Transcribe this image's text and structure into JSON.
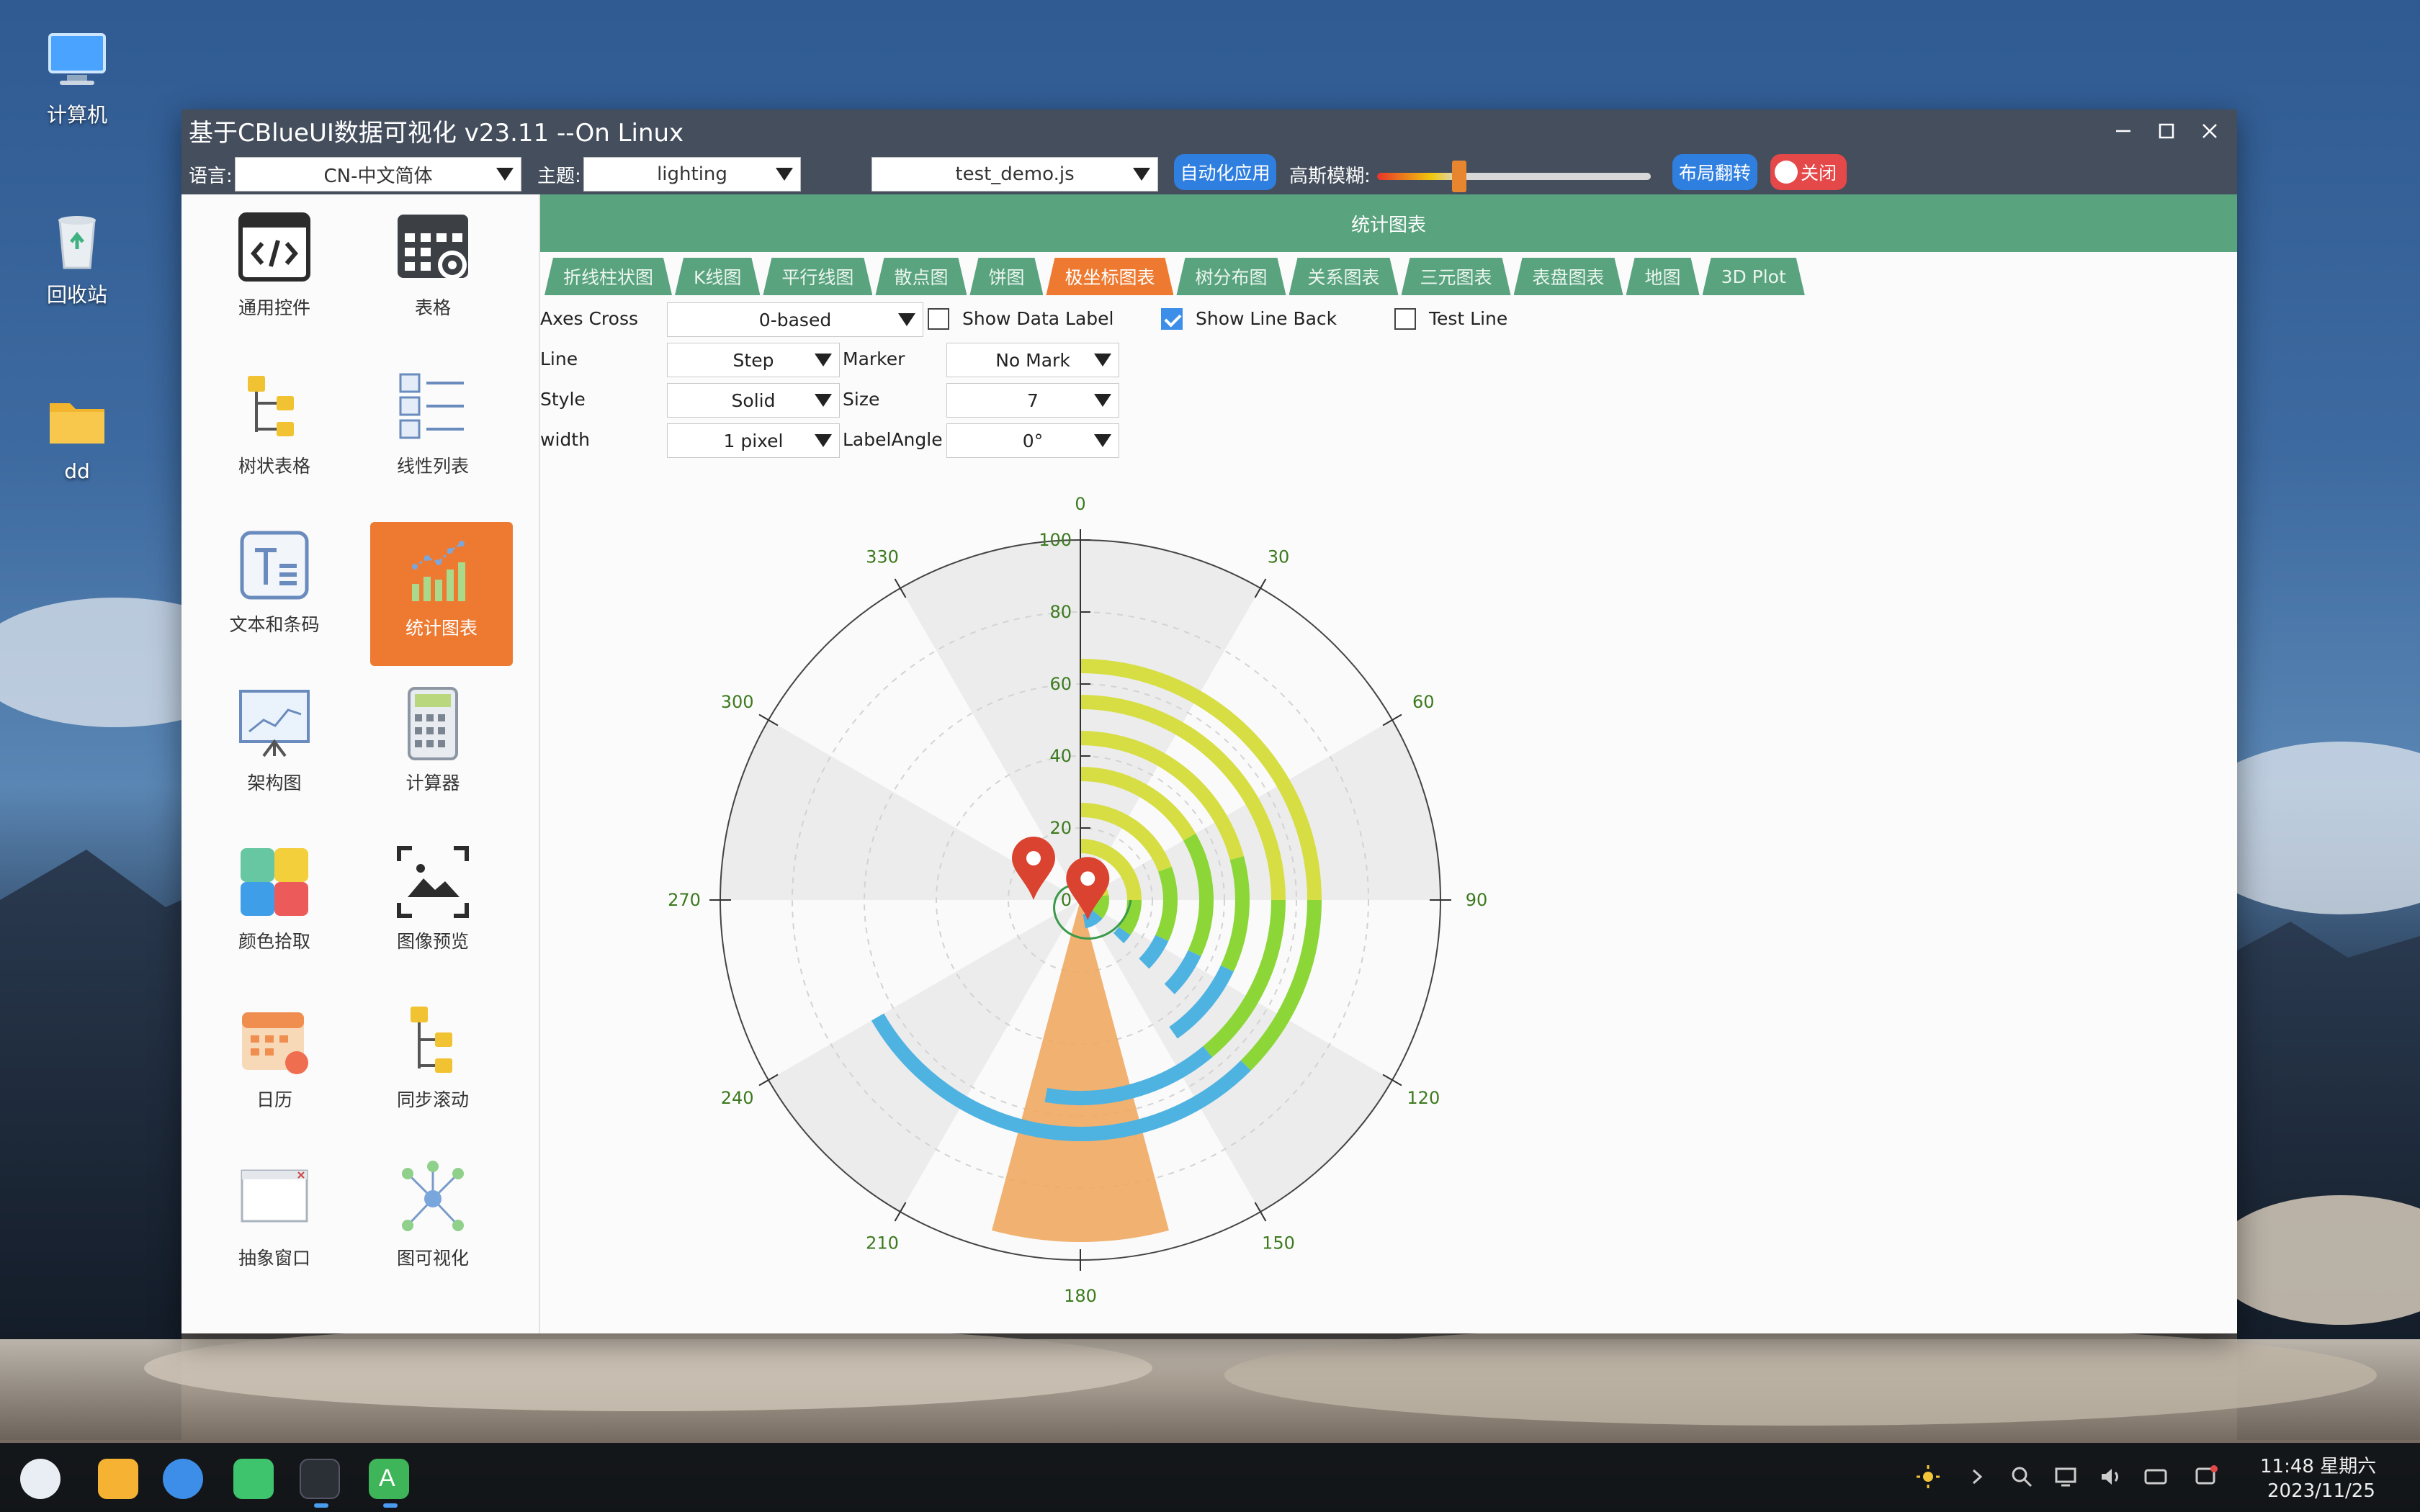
{
  "desktop": {
    "icons": [
      {
        "label": "计算机",
        "icon": "computer-icon"
      },
      {
        "label": "回收站",
        "icon": "trash-icon"
      },
      {
        "label": "dd",
        "icon": "folder-icon"
      }
    ]
  },
  "window": {
    "title": "基于CBlueUI数据可视化 v23.11 --On Linux",
    "controls": [
      "minimize-icon",
      "maximize-icon",
      "close-icon"
    ]
  },
  "toolbar": {
    "language_label": "语言:",
    "language_value": "CN-中文简体",
    "theme_label": "主题:",
    "theme_value": "lighting",
    "script_value": "test_demo.js",
    "auto_apply_label": "自动化应用",
    "blur_label": "高斯模糊:",
    "blur_level": 0.3,
    "layout_flip_label": "布局翻转",
    "close_label": "关闭"
  },
  "sidebar": {
    "items": [
      {
        "label": "通用控件",
        "icon": "code-icon"
      },
      {
        "label": "表格",
        "icon": "table-gear-icon"
      },
      {
        "label": "树状表格",
        "icon": "tree-table-icon"
      },
      {
        "label": "线性列表",
        "icon": "list-icon"
      },
      {
        "label": "文本和条码",
        "icon": "text-icon"
      },
      {
        "label": "统计图表",
        "icon": "chart-icon",
        "active": true
      },
      {
        "label": "架构图",
        "icon": "board-icon"
      },
      {
        "label": "计算器",
        "icon": "calculator-icon"
      },
      {
        "label": "颜色拾取",
        "icon": "palette-icon"
      },
      {
        "label": "图像预览",
        "icon": "image-preview-icon"
      },
      {
        "label": "日历",
        "icon": "calendar-icon"
      },
      {
        "label": "同步滚动",
        "icon": "sync-scroll-icon"
      },
      {
        "label": "抽象窗口",
        "icon": "window-icon"
      },
      {
        "label": "图可视化",
        "icon": "graph-icon"
      }
    ]
  },
  "main": {
    "header": "统计图表",
    "tabs": [
      "折线柱状图",
      "K线图",
      "平行线图",
      "散点图",
      "饼图",
      "极坐标图表",
      "树分布图",
      "关系图表",
      "三元图表",
      "表盘图表",
      "地图",
      "3D Plot"
    ],
    "active_tab": 5,
    "controls": {
      "axes_cross_label": "Axes Cross",
      "axes_cross_value": "0-based",
      "show_data_label": "Show Data Label",
      "show_data_label_checked": false,
      "show_line_back": "Show Line Back",
      "show_line_back_checked": true,
      "test_line": "Test Line",
      "test_line_checked": false,
      "line_label": "Line",
      "line_value": "Step",
      "marker_label": "Marker",
      "marker_value": "No Mark",
      "style_label": "Style",
      "style_value": "Solid",
      "size_label": "Size",
      "size_value": "7",
      "width_label": "width",
      "width_value": "1 pixel",
      "label_angle_label": "LabelAngle",
      "label_angle_value": "0°"
    }
  },
  "chart_data": {
    "type": "polar",
    "angle_ticks": [
      0,
      30,
      60,
      90,
      120,
      150,
      180,
      210,
      240,
      270,
      300,
      330
    ],
    "radius_ticks": [
      0,
      20,
      40,
      60,
      80,
      100
    ],
    "rlim": [
      0,
      100
    ],
    "background_sectors": [
      {
        "start": 0,
        "end": 30,
        "r": 100
      },
      {
        "start": 60,
        "end": 90,
        "r": 100
      },
      {
        "start": 120,
        "end": 150,
        "r": 100
      },
      {
        "start": 210,
        "end": 240,
        "r": 100
      },
      {
        "start": 270,
        "end": 300,
        "r": 100
      },
      {
        "start": 330,
        "end": 360,
        "r": 100
      }
    ],
    "orange_sector": {
      "start": 165,
      "end": 195,
      "r": 95,
      "color": "#f0a860"
    },
    "rings": [
      {
        "r": 65,
        "segments": [
          {
            "start": 0,
            "end": 90,
            "color": "#d6de44"
          },
          {
            "start": 90,
            "end": 135,
            "color": "#8dd638"
          },
          {
            "start": 135,
            "end": 240,
            "color": "#4fb3e2"
          }
        ]
      },
      {
        "r": 55,
        "segments": [
          {
            "start": 0,
            "end": 90,
            "color": "#d6de44"
          },
          {
            "start": 90,
            "end": 140,
            "color": "#8dd638"
          },
          {
            "start": 140,
            "end": 190,
            "color": "#4fb3e2"
          }
        ]
      },
      {
        "r": 45,
        "segments": [
          {
            "start": 0,
            "end": 75,
            "color": "#d6de44"
          },
          {
            "start": 75,
            "end": 115,
            "color": "#8dd638"
          },
          {
            "start": 115,
            "end": 145,
            "color": "#4fb3e2"
          }
        ]
      },
      {
        "r": 35,
        "segments": [
          {
            "start": 0,
            "end": 60,
            "color": "#d6de44"
          },
          {
            "start": 60,
            "end": 115,
            "color": "#8dd638"
          },
          {
            "start": 115,
            "end": 135,
            "color": "#4fb3e2"
          }
        ]
      },
      {
        "r": 25,
        "segments": [
          {
            "start": 0,
            "end": 70,
            "color": "#d6de44"
          },
          {
            "start": 70,
            "end": 115,
            "color": "#8dd638"
          },
          {
            "start": 115,
            "end": 135,
            "color": "#4fb3e2"
          }
        ]
      },
      {
        "r": 15,
        "segments": [
          {
            "start": 0,
            "end": 90,
            "color": "#d6de44"
          },
          {
            "start": 90,
            "end": 125,
            "color": "#8dd638"
          },
          {
            "start": 125,
            "end": 135,
            "color": "#4fb3e2"
          }
        ]
      },
      {
        "r": 6,
        "segments": [
          {
            "start": 0,
            "end": 80,
            "color": "#d6de44"
          },
          {
            "start": 80,
            "end": 130,
            "color": "#8dd638"
          },
          {
            "start": 130,
            "end": 170,
            "color": "#4fb3e2"
          }
        ]
      }
    ],
    "spiral_color": "#3a9a4a",
    "markers": [
      {
        "angle": 270,
        "r": 13,
        "color": "#d9432f"
      },
      {
        "angle": 160,
        "r": 6,
        "color": "#d9432f"
      }
    ],
    "grid": true
  },
  "taskbar": {
    "time": "11:48 星期六",
    "date": "2023/11/25",
    "apps": [
      "launcher-icon",
      "files-icon",
      "browser-icon",
      "mail-icon",
      "terminal-icon",
      "app-a-icon"
    ],
    "tray": [
      "brightness-icon",
      "chevron-right-icon",
      "search-icon",
      "screen-icon",
      "volume-icon",
      "keyboard-icon",
      "notification-icon"
    ]
  }
}
